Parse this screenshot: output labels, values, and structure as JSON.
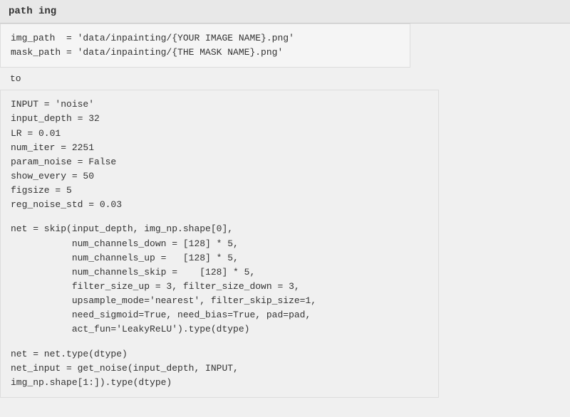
{
  "topbar": {
    "label": "path ing"
  },
  "code_section_1": {
    "lines": [
      "img_path  = 'data/inpainting/{YOUR IMAGE NAME}.png'",
      "mask_path = 'data/inpainting/{THE MASK NAME}.png'"
    ]
  },
  "to_label": "to",
  "code_section_2": {
    "lines": [
      "INPUT = 'noise'",
      "input_depth = 32",
      "LR = 0.01",
      "num_iter = 2251",
      "param_noise = False",
      "show_every = 50",
      "figsize = 5",
      "reg_noise_std = 0.03",
      "",
      "net = skip(input_depth, img_np.shape[0],",
      "           num_channels_down = [128] * 5,",
      "           num_channels_up =   [128] * 5,",
      "           num_channels_skip =    [128] * 5,",
      "           filter_size_up = 3, filter_size_down = 3,",
      "           upsample_mode='nearest', filter_skip_size=1,",
      "           need_sigmoid=True, need_bias=True, pad=pad,",
      "           act_fun='LeakyReLU').type(dtype)",
      "",
      "net = net.type(dtype)",
      "net_input = get_noise(input_depth, INPUT,",
      "img_np.shape[1:]).type(dtype)"
    ]
  }
}
